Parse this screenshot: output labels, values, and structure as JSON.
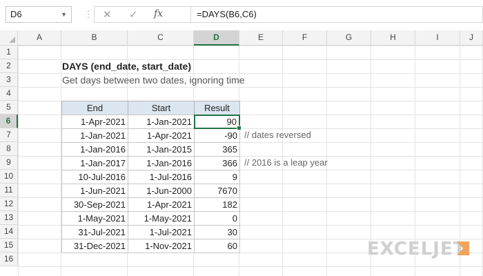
{
  "formula_bar": {
    "name_box": "D6",
    "cancel_glyph": "✕",
    "confirm_glyph": "✓",
    "fx_label": "fx",
    "formula": "=DAYS(B6,C6)"
  },
  "columns": [
    "A",
    "B",
    "C",
    "D",
    "E",
    "F",
    "G",
    "H",
    "I",
    "J"
  ],
  "rows": [
    "1",
    "2",
    "3",
    "4",
    "5",
    "6",
    "7",
    "8",
    "9",
    "10",
    "11",
    "12",
    "13",
    "14",
    "15",
    "16"
  ],
  "selected_cell": "D6",
  "sheet": {
    "title": "DAYS (end_date, start_date)",
    "subtitle": "Get days between two dates, ignoring time",
    "table_headers": [
      "End",
      "Start",
      "Result"
    ],
    "table_rows": [
      {
        "end": "1-Apr-2021",
        "start": "1-Jan-2021",
        "result": "90",
        "note": ""
      },
      {
        "end": "1-Jan-2021",
        "start": "1-Apr-2021",
        "result": "-90",
        "note": "// dates reversed"
      },
      {
        "end": "1-Jan-2016",
        "start": "1-Jan-2015",
        "result": "365",
        "note": ""
      },
      {
        "end": "1-Jan-2017",
        "start": "1-Jan-2016",
        "result": "366",
        "note": "// 2016 is a leap year"
      },
      {
        "end": "10-Jul-2016",
        "start": "1-Jul-2016",
        "result": "9",
        "note": ""
      },
      {
        "end": "1-Jun-2021",
        "start": "1-Jun-2000",
        "result": "7670",
        "note": ""
      },
      {
        "end": "30-Sep-2021",
        "start": "1-Apr-2021",
        "result": "182",
        "note": ""
      },
      {
        "end": "1-May-2021",
        "start": "1-May-2021",
        "result": "0",
        "note": ""
      },
      {
        "end": "31-Jul-2021",
        "start": "1-Jul-2021",
        "result": "30",
        "note": ""
      },
      {
        "end": "31-Dec-2021",
        "start": "1-Nov-2021",
        "result": "60",
        "note": ""
      }
    ]
  },
  "logo": {
    "text": "EXCELJET",
    "color": "#cfcfcf",
    "accent": "#f0a35e"
  },
  "colors": {
    "accent": "#217346",
    "header_fill": "#dce6f1"
  }
}
